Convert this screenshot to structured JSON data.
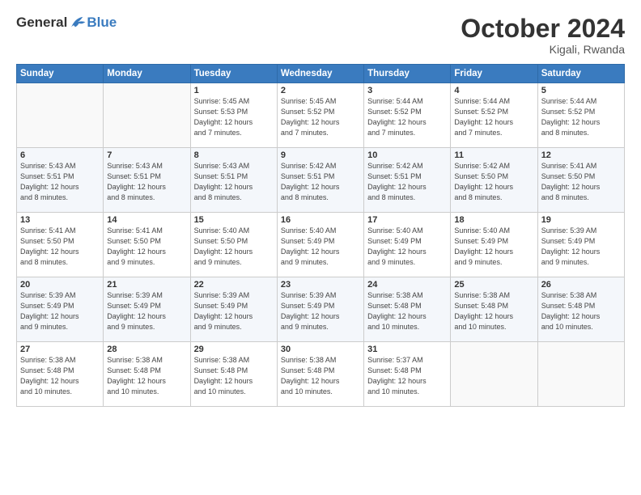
{
  "logo": {
    "general": "General",
    "blue": "Blue"
  },
  "header": {
    "month": "October 2024",
    "location": "Kigali, Rwanda"
  },
  "weekdays": [
    "Sunday",
    "Monday",
    "Tuesday",
    "Wednesday",
    "Thursday",
    "Friday",
    "Saturday"
  ],
  "weeks": [
    [
      {
        "day": "",
        "info": ""
      },
      {
        "day": "",
        "info": ""
      },
      {
        "day": "1",
        "info": "Sunrise: 5:45 AM\nSunset: 5:53 PM\nDaylight: 12 hours\nand 7 minutes."
      },
      {
        "day": "2",
        "info": "Sunrise: 5:45 AM\nSunset: 5:52 PM\nDaylight: 12 hours\nand 7 minutes."
      },
      {
        "day": "3",
        "info": "Sunrise: 5:44 AM\nSunset: 5:52 PM\nDaylight: 12 hours\nand 7 minutes."
      },
      {
        "day": "4",
        "info": "Sunrise: 5:44 AM\nSunset: 5:52 PM\nDaylight: 12 hours\nand 7 minutes."
      },
      {
        "day": "5",
        "info": "Sunrise: 5:44 AM\nSunset: 5:52 PM\nDaylight: 12 hours\nand 8 minutes."
      }
    ],
    [
      {
        "day": "6",
        "info": "Sunrise: 5:43 AM\nSunset: 5:51 PM\nDaylight: 12 hours\nand 8 minutes."
      },
      {
        "day": "7",
        "info": "Sunrise: 5:43 AM\nSunset: 5:51 PM\nDaylight: 12 hours\nand 8 minutes."
      },
      {
        "day": "8",
        "info": "Sunrise: 5:43 AM\nSunset: 5:51 PM\nDaylight: 12 hours\nand 8 minutes."
      },
      {
        "day": "9",
        "info": "Sunrise: 5:42 AM\nSunset: 5:51 PM\nDaylight: 12 hours\nand 8 minutes."
      },
      {
        "day": "10",
        "info": "Sunrise: 5:42 AM\nSunset: 5:51 PM\nDaylight: 12 hours\nand 8 minutes."
      },
      {
        "day": "11",
        "info": "Sunrise: 5:42 AM\nSunset: 5:50 PM\nDaylight: 12 hours\nand 8 minutes."
      },
      {
        "day": "12",
        "info": "Sunrise: 5:41 AM\nSunset: 5:50 PM\nDaylight: 12 hours\nand 8 minutes."
      }
    ],
    [
      {
        "day": "13",
        "info": "Sunrise: 5:41 AM\nSunset: 5:50 PM\nDaylight: 12 hours\nand 8 minutes."
      },
      {
        "day": "14",
        "info": "Sunrise: 5:41 AM\nSunset: 5:50 PM\nDaylight: 12 hours\nand 9 minutes."
      },
      {
        "day": "15",
        "info": "Sunrise: 5:40 AM\nSunset: 5:50 PM\nDaylight: 12 hours\nand 9 minutes."
      },
      {
        "day": "16",
        "info": "Sunrise: 5:40 AM\nSunset: 5:49 PM\nDaylight: 12 hours\nand 9 minutes."
      },
      {
        "day": "17",
        "info": "Sunrise: 5:40 AM\nSunset: 5:49 PM\nDaylight: 12 hours\nand 9 minutes."
      },
      {
        "day": "18",
        "info": "Sunrise: 5:40 AM\nSunset: 5:49 PM\nDaylight: 12 hours\nand 9 minutes."
      },
      {
        "day": "19",
        "info": "Sunrise: 5:39 AM\nSunset: 5:49 PM\nDaylight: 12 hours\nand 9 minutes."
      }
    ],
    [
      {
        "day": "20",
        "info": "Sunrise: 5:39 AM\nSunset: 5:49 PM\nDaylight: 12 hours\nand 9 minutes."
      },
      {
        "day": "21",
        "info": "Sunrise: 5:39 AM\nSunset: 5:49 PM\nDaylight: 12 hours\nand 9 minutes."
      },
      {
        "day": "22",
        "info": "Sunrise: 5:39 AM\nSunset: 5:49 PM\nDaylight: 12 hours\nand 9 minutes."
      },
      {
        "day": "23",
        "info": "Sunrise: 5:39 AM\nSunset: 5:49 PM\nDaylight: 12 hours\nand 9 minutes."
      },
      {
        "day": "24",
        "info": "Sunrise: 5:38 AM\nSunset: 5:48 PM\nDaylight: 12 hours\nand 10 minutes."
      },
      {
        "day": "25",
        "info": "Sunrise: 5:38 AM\nSunset: 5:48 PM\nDaylight: 12 hours\nand 10 minutes."
      },
      {
        "day": "26",
        "info": "Sunrise: 5:38 AM\nSunset: 5:48 PM\nDaylight: 12 hours\nand 10 minutes."
      }
    ],
    [
      {
        "day": "27",
        "info": "Sunrise: 5:38 AM\nSunset: 5:48 PM\nDaylight: 12 hours\nand 10 minutes."
      },
      {
        "day": "28",
        "info": "Sunrise: 5:38 AM\nSunset: 5:48 PM\nDaylight: 12 hours\nand 10 minutes."
      },
      {
        "day": "29",
        "info": "Sunrise: 5:38 AM\nSunset: 5:48 PM\nDaylight: 12 hours\nand 10 minutes."
      },
      {
        "day": "30",
        "info": "Sunrise: 5:38 AM\nSunset: 5:48 PM\nDaylight: 12 hours\nand 10 minutes."
      },
      {
        "day": "31",
        "info": "Sunrise: 5:37 AM\nSunset: 5:48 PM\nDaylight: 12 hours\nand 10 minutes."
      },
      {
        "day": "",
        "info": ""
      },
      {
        "day": "",
        "info": ""
      }
    ]
  ]
}
